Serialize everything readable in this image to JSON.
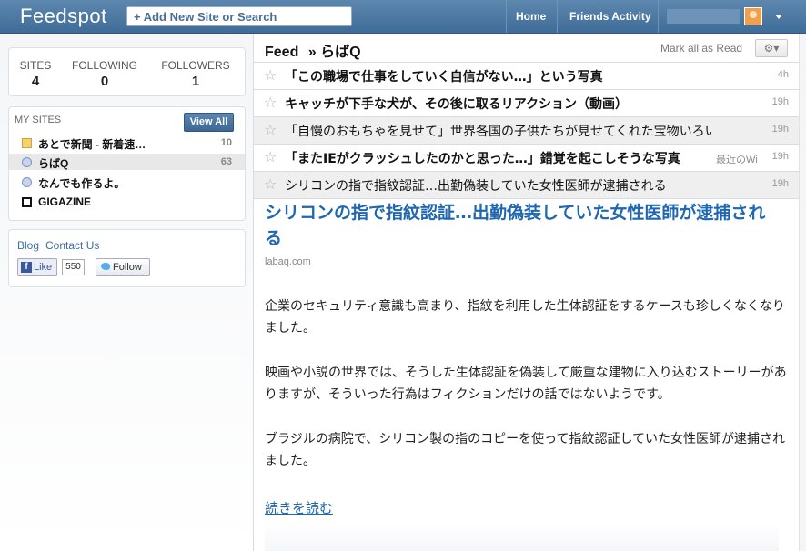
{
  "topbar": {
    "logo": "Feedspot",
    "add_site": "+ Add New Site or Search",
    "nav": [
      "Home",
      "Friends Activity"
    ]
  },
  "stats": [
    {
      "label": "SITES",
      "value": "4"
    },
    {
      "label": "FOLLOWING",
      "value": "0"
    },
    {
      "label": "FOLLOWERS",
      "value": "1"
    }
  ],
  "mysites": {
    "title": "MY SITES",
    "view_all": "View All",
    "items": [
      {
        "name": "あとで新聞 - 新着速…",
        "count": "10",
        "icon": "note-icon"
      },
      {
        "name": "らばQ",
        "count": "63",
        "icon": "clock-icon"
      },
      {
        "name": "なんでも作るよ。",
        "count": "",
        "icon": "clock-icon"
      },
      {
        "name": "GIGAZINE",
        "count": "",
        "icon": "gigazine-icon"
      }
    ]
  },
  "social": {
    "blog": "Blog",
    "contact": "Contact Us",
    "like": "Like",
    "like_count": "550",
    "follow": "Follow"
  },
  "feed": {
    "label": "Feed",
    "sep": "»",
    "site": "らばQ",
    "mark_read": "Mark all as Read",
    "items": [
      {
        "title": "「この職場で仕事をしていく自信がない…」という写真",
        "time": "4h",
        "source": ""
      },
      {
        "title": "キャッチが下手な犬が、その後に取るリアクション（動画）",
        "time": "19h",
        "source": ""
      },
      {
        "title": "「自慢のおもちゃを見せて」世界各国の子供たちが見せてくれた宝物いろいろ",
        "time": "19h",
        "source": ""
      },
      {
        "title": "「またIEがクラッシュしたのかと思った…」錯覚を起こしそうな写真",
        "time": "19h",
        "source": "最近のWi"
      },
      {
        "title": "シリコンの指で指紋認証…出勤偽装していた女性医師が逮捕される",
        "time": "19h",
        "source": ""
      }
    ]
  },
  "article": {
    "title": "シリコンの指で指紋認証…出勤偽装していた女性医師が逮捕される",
    "domain": "labaq.com",
    "paragraphs": [
      "企業のセキュリティ意識も高まり、指紋を利用した生体認証をするケースも珍しくなくなりました。",
      "映画や小説の世界では、そうした生体認証を偽装して厳重な建物に入り込むストーリーがありますが、そういった行為はフィクションだけの話ではないようです。",
      "ブラジルの病院で、シリコン製の指のコピーを使って指紋認証していた女性医師が逮捕されました。"
    ],
    "read_more": "続きを読む"
  }
}
